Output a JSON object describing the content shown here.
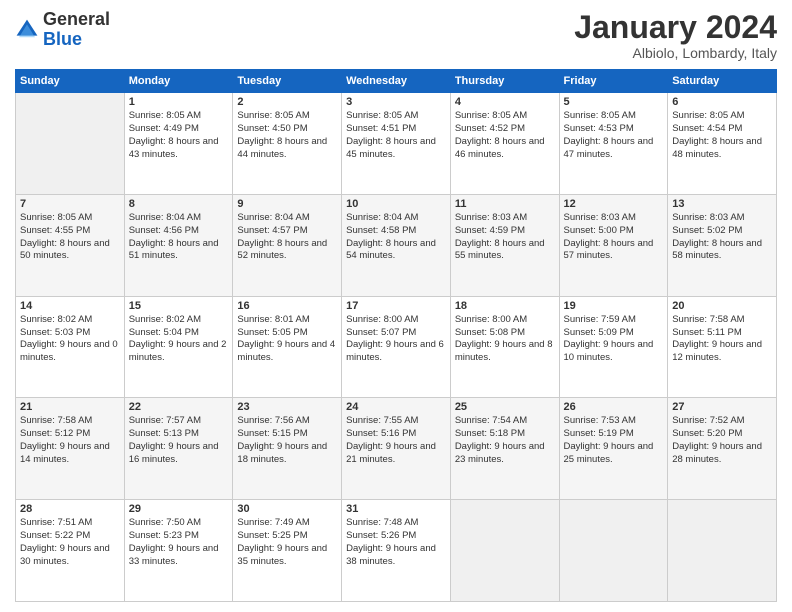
{
  "header": {
    "logo_general": "General",
    "logo_blue": "Blue",
    "month_title": "January 2024",
    "location": "Albiolo, Lombardy, Italy"
  },
  "weekdays": [
    "Sunday",
    "Monday",
    "Tuesday",
    "Wednesday",
    "Thursday",
    "Friday",
    "Saturday"
  ],
  "weeks": [
    [
      {
        "day": "",
        "empty": true
      },
      {
        "day": "1",
        "sunrise": "Sunrise: 8:05 AM",
        "sunset": "Sunset: 4:49 PM",
        "daylight": "Daylight: 8 hours and 43 minutes."
      },
      {
        "day": "2",
        "sunrise": "Sunrise: 8:05 AM",
        "sunset": "Sunset: 4:50 PM",
        "daylight": "Daylight: 8 hours and 44 minutes."
      },
      {
        "day": "3",
        "sunrise": "Sunrise: 8:05 AM",
        "sunset": "Sunset: 4:51 PM",
        "daylight": "Daylight: 8 hours and 45 minutes."
      },
      {
        "day": "4",
        "sunrise": "Sunrise: 8:05 AM",
        "sunset": "Sunset: 4:52 PM",
        "daylight": "Daylight: 8 hours and 46 minutes."
      },
      {
        "day": "5",
        "sunrise": "Sunrise: 8:05 AM",
        "sunset": "Sunset: 4:53 PM",
        "daylight": "Daylight: 8 hours and 47 minutes."
      },
      {
        "day": "6",
        "sunrise": "Sunrise: 8:05 AM",
        "sunset": "Sunset: 4:54 PM",
        "daylight": "Daylight: 8 hours and 48 minutes."
      }
    ],
    [
      {
        "day": "7",
        "sunrise": "Sunrise: 8:05 AM",
        "sunset": "Sunset: 4:55 PM",
        "daylight": "Daylight: 8 hours and 50 minutes."
      },
      {
        "day": "8",
        "sunrise": "Sunrise: 8:04 AM",
        "sunset": "Sunset: 4:56 PM",
        "daylight": "Daylight: 8 hours and 51 minutes."
      },
      {
        "day": "9",
        "sunrise": "Sunrise: 8:04 AM",
        "sunset": "Sunset: 4:57 PM",
        "daylight": "Daylight: 8 hours and 52 minutes."
      },
      {
        "day": "10",
        "sunrise": "Sunrise: 8:04 AM",
        "sunset": "Sunset: 4:58 PM",
        "daylight": "Daylight: 8 hours and 54 minutes."
      },
      {
        "day": "11",
        "sunrise": "Sunrise: 8:03 AM",
        "sunset": "Sunset: 4:59 PM",
        "daylight": "Daylight: 8 hours and 55 minutes."
      },
      {
        "day": "12",
        "sunrise": "Sunrise: 8:03 AM",
        "sunset": "Sunset: 5:00 PM",
        "daylight": "Daylight: 8 hours and 57 minutes."
      },
      {
        "day": "13",
        "sunrise": "Sunrise: 8:03 AM",
        "sunset": "Sunset: 5:02 PM",
        "daylight": "Daylight: 8 hours and 58 minutes."
      }
    ],
    [
      {
        "day": "14",
        "sunrise": "Sunrise: 8:02 AM",
        "sunset": "Sunset: 5:03 PM",
        "daylight": "Daylight: 9 hours and 0 minutes."
      },
      {
        "day": "15",
        "sunrise": "Sunrise: 8:02 AM",
        "sunset": "Sunset: 5:04 PM",
        "daylight": "Daylight: 9 hours and 2 minutes."
      },
      {
        "day": "16",
        "sunrise": "Sunrise: 8:01 AM",
        "sunset": "Sunset: 5:05 PM",
        "daylight": "Daylight: 9 hours and 4 minutes."
      },
      {
        "day": "17",
        "sunrise": "Sunrise: 8:00 AM",
        "sunset": "Sunset: 5:07 PM",
        "daylight": "Daylight: 9 hours and 6 minutes."
      },
      {
        "day": "18",
        "sunrise": "Sunrise: 8:00 AM",
        "sunset": "Sunset: 5:08 PM",
        "daylight": "Daylight: 9 hours and 8 minutes."
      },
      {
        "day": "19",
        "sunrise": "Sunrise: 7:59 AM",
        "sunset": "Sunset: 5:09 PM",
        "daylight": "Daylight: 9 hours and 10 minutes."
      },
      {
        "day": "20",
        "sunrise": "Sunrise: 7:58 AM",
        "sunset": "Sunset: 5:11 PM",
        "daylight": "Daylight: 9 hours and 12 minutes."
      }
    ],
    [
      {
        "day": "21",
        "sunrise": "Sunrise: 7:58 AM",
        "sunset": "Sunset: 5:12 PM",
        "daylight": "Daylight: 9 hours and 14 minutes."
      },
      {
        "day": "22",
        "sunrise": "Sunrise: 7:57 AM",
        "sunset": "Sunset: 5:13 PM",
        "daylight": "Daylight: 9 hours and 16 minutes."
      },
      {
        "day": "23",
        "sunrise": "Sunrise: 7:56 AM",
        "sunset": "Sunset: 5:15 PM",
        "daylight": "Daylight: 9 hours and 18 minutes."
      },
      {
        "day": "24",
        "sunrise": "Sunrise: 7:55 AM",
        "sunset": "Sunset: 5:16 PM",
        "daylight": "Daylight: 9 hours and 21 minutes."
      },
      {
        "day": "25",
        "sunrise": "Sunrise: 7:54 AM",
        "sunset": "Sunset: 5:18 PM",
        "daylight": "Daylight: 9 hours and 23 minutes."
      },
      {
        "day": "26",
        "sunrise": "Sunrise: 7:53 AM",
        "sunset": "Sunset: 5:19 PM",
        "daylight": "Daylight: 9 hours and 25 minutes."
      },
      {
        "day": "27",
        "sunrise": "Sunrise: 7:52 AM",
        "sunset": "Sunset: 5:20 PM",
        "daylight": "Daylight: 9 hours and 28 minutes."
      }
    ],
    [
      {
        "day": "28",
        "sunrise": "Sunrise: 7:51 AM",
        "sunset": "Sunset: 5:22 PM",
        "daylight": "Daylight: 9 hours and 30 minutes."
      },
      {
        "day": "29",
        "sunrise": "Sunrise: 7:50 AM",
        "sunset": "Sunset: 5:23 PM",
        "daylight": "Daylight: 9 hours and 33 minutes."
      },
      {
        "day": "30",
        "sunrise": "Sunrise: 7:49 AM",
        "sunset": "Sunset: 5:25 PM",
        "daylight": "Daylight: 9 hours and 35 minutes."
      },
      {
        "day": "31",
        "sunrise": "Sunrise: 7:48 AM",
        "sunset": "Sunset: 5:26 PM",
        "daylight": "Daylight: 9 hours and 38 minutes."
      },
      {
        "day": "",
        "empty": true
      },
      {
        "day": "",
        "empty": true
      },
      {
        "day": "",
        "empty": true
      }
    ]
  ]
}
